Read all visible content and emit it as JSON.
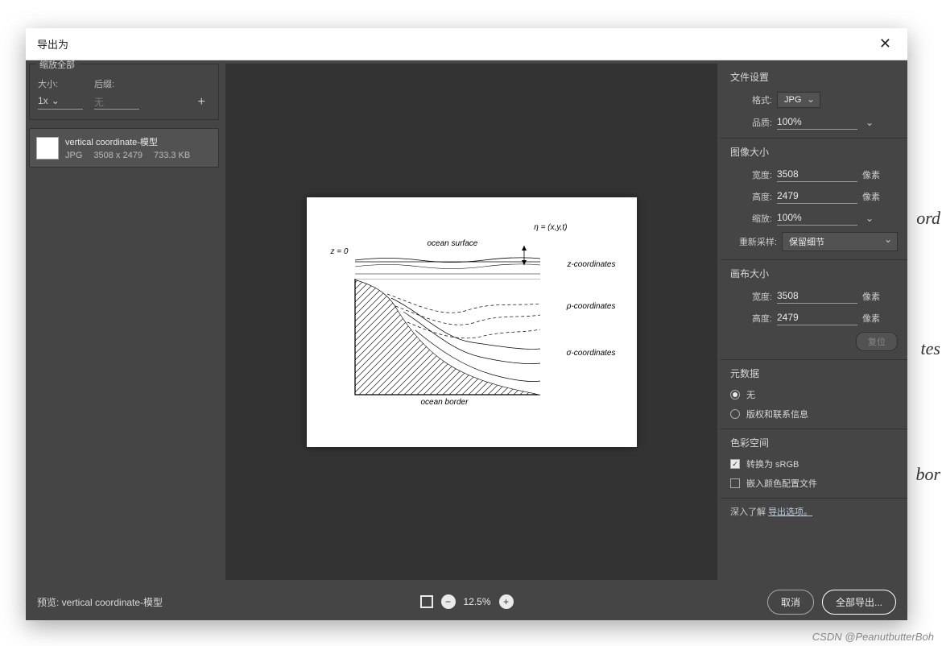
{
  "background_hints": [
    "ord",
    "tes",
    "bor"
  ],
  "dialog": {
    "title": "导出为",
    "close": "✕"
  },
  "left": {
    "scale_all": "缩放全部",
    "size_label": "大小:",
    "suffix_label": "后缀:",
    "size_value": "1x",
    "suffix_placeholder": "无",
    "add": "+",
    "asset": {
      "name": "vertical coordinate-模型",
      "format": "JPG",
      "dims": "3508 x 2479",
      "filesize": "733.3 KB"
    }
  },
  "preview": {
    "labels": {
      "eta": "η = (x,y,t)",
      "surface": "ocean surface",
      "z0": "z = 0",
      "zcoord": "z-coordinates",
      "rhocoord": "ρ-coordinates",
      "sigmacoord": "σ-coordinates",
      "border": "ocean border"
    }
  },
  "right": {
    "file_settings": "文件设置",
    "format_label": "格式:",
    "format_value": "JPG",
    "quality_label": "品质:",
    "quality_value": "100%",
    "image_size": "图像大小",
    "width_label": "宽度:",
    "height_label": "高度:",
    "scale_label": "缩放:",
    "resample_label": "重新采样:",
    "image_width": "3508",
    "image_height": "2479",
    "image_scale": "100%",
    "resample_value": "保留细节",
    "px_unit": "像素",
    "canvas_size": "画布大小",
    "canvas_width": "3508",
    "canvas_height": "2479",
    "reset_btn": "复位",
    "metadata": "元数据",
    "meta_none": "无",
    "meta_copyright": "版权和联系信息",
    "color_space": "色彩空间",
    "convert_srgb": "转换为 sRGB",
    "embed_profile": "嵌入颜色配置文件",
    "learn_more_prefix": "深入了解 ",
    "learn_more_link": "导出选项。"
  },
  "footer": {
    "preview_label": "预览: vertical coordinate-模型",
    "zoom_value": "12.5%",
    "cancel": "取消",
    "export_all": "全部导出..."
  },
  "watermark": "CSDN @PeanutbutterBoh"
}
